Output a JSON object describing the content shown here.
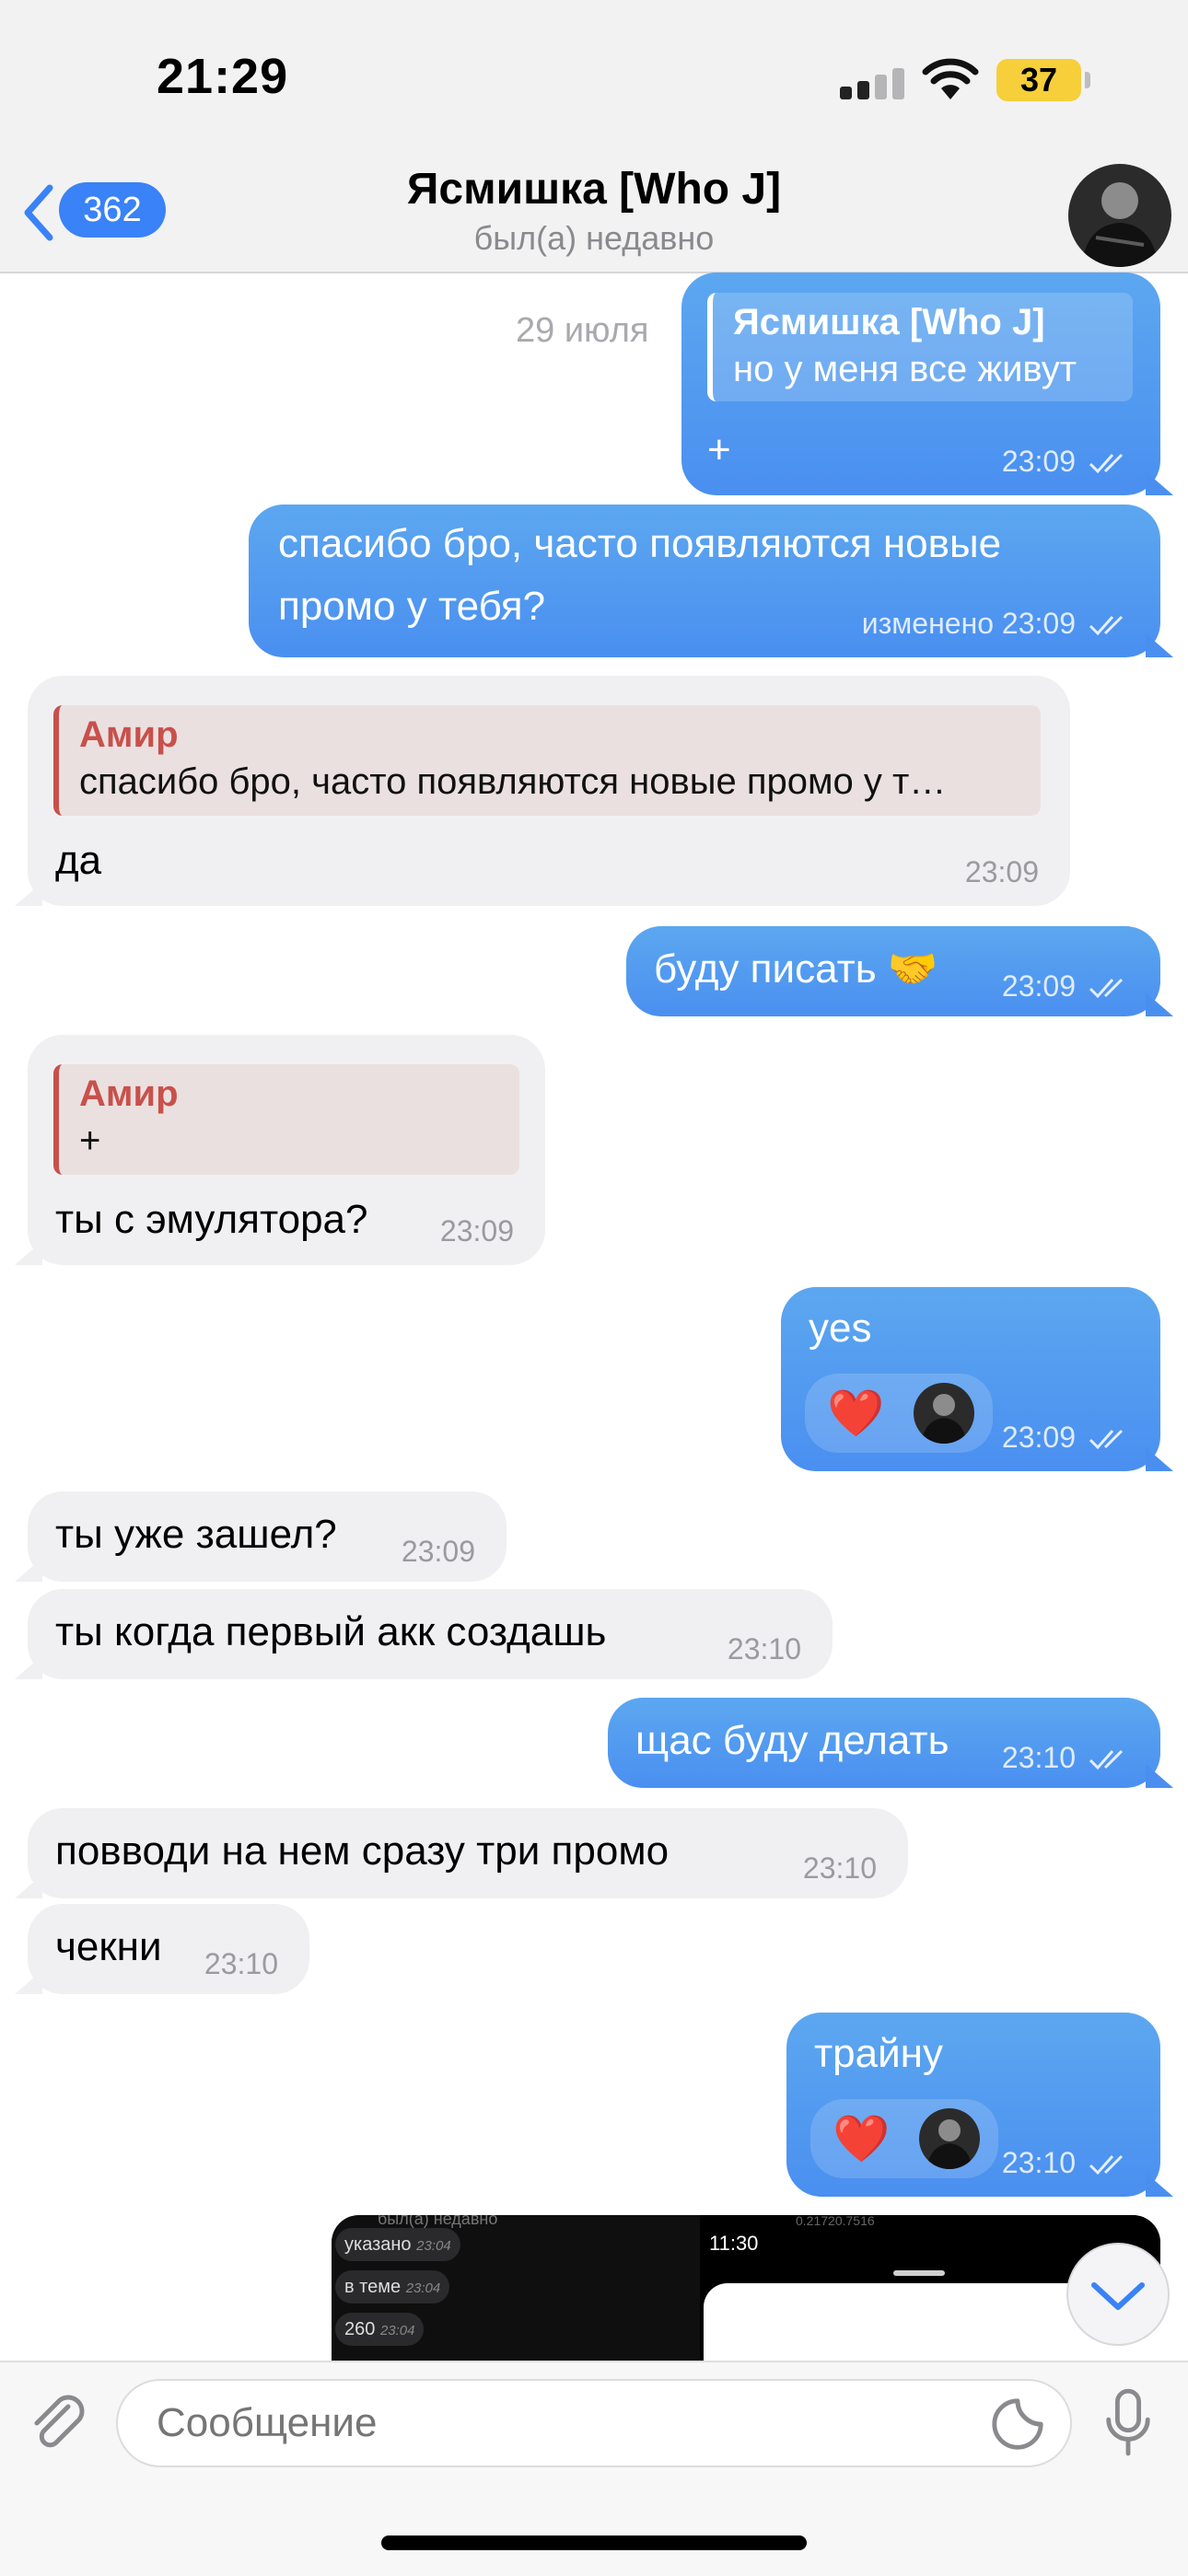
{
  "status_bar": {
    "time": "21:29",
    "battery": "37",
    "battery_color": "#f6cf3a"
  },
  "header": {
    "back_count": "362",
    "chat_name": "Ясмишка [Who J]",
    "chat_status": "был(а) недавно"
  },
  "date_label": "29 июля",
  "messages": [
    {
      "side": "out",
      "reply_name": "Ясмишка [Who J]",
      "reply_text": "но у меня все живут",
      "text": "+",
      "time": "23:09",
      "read": true
    },
    {
      "side": "out",
      "text_line1": "спасибо бро, часто появляются новые",
      "text_line2": "промо у тебя?",
      "time": "изменено 23:09",
      "read": true
    },
    {
      "side": "in",
      "reply_name": "Амир",
      "reply_text": "спасибо бро, часто появляются новые промо у т…",
      "text": "да",
      "time": "23:09"
    },
    {
      "side": "out",
      "text": "буду писать 🤝",
      "time": "23:09",
      "read": true
    },
    {
      "side": "in",
      "reply_name": "Амир",
      "reply_text": "+",
      "text": "ты с эмулятора?",
      "time": "23:09"
    },
    {
      "side": "out",
      "text": "yes",
      "reaction": "❤️",
      "time": "23:09",
      "read": true
    },
    {
      "side": "in",
      "text": "ты уже зашел?",
      "time": "23:09"
    },
    {
      "side": "in",
      "text": "ты когда первый акк создашь",
      "time": "23:10"
    },
    {
      "side": "out",
      "text": "щас буду делать",
      "time": "23:10",
      "read": true
    },
    {
      "side": "in",
      "text": "повводи на нем сразу три промо",
      "time": "23:10"
    },
    {
      "side": "in",
      "text": "чекни",
      "time": "23:10"
    },
    {
      "side": "out",
      "text": "трайну",
      "reaction": "❤️",
      "time": "23:10",
      "read": true
    }
  ],
  "photo_preview": {
    "top_text": "был(а) недавно",
    "rows": [
      {
        "text": "указано",
        "time": "23:04"
      },
      {
        "text": "в теме",
        "time": "23:04"
      },
      {
        "text": "260",
        "time": "23:04"
      }
    ],
    "inner_time": "11:30",
    "inner_top": "0.21720.7516"
  },
  "composer": {
    "placeholder": "Сообщение"
  }
}
